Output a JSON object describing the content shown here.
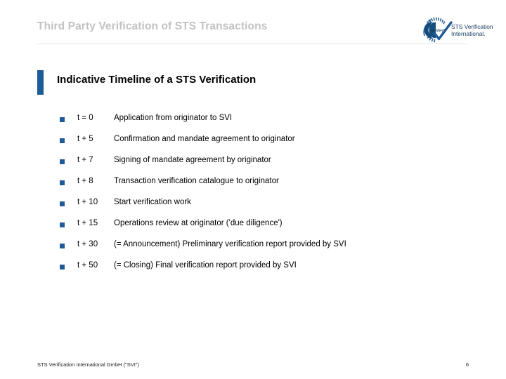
{
  "slide": {
    "title": "Third Party Verification of STS Transactions",
    "section_heading": "Indicative Timeline of a STS Verification",
    "accent_color": "#1f5b96",
    "title_color": "#c2c2c2"
  },
  "logo": {
    "badge_label": "verified",
    "icon": "verified-check-badge-icon",
    "line1": "STS Verification",
    "line2": "International.",
    "color": "#16395e"
  },
  "timeline": {
    "items": [
      {
        "time": "t = 0",
        "desc": "Application from originator to SVI"
      },
      {
        "time": "t + 5",
        "desc": "Confirmation and mandate agreement to originator"
      },
      {
        "time": "t + 7",
        "desc": "Signing of mandate agreement by originator"
      },
      {
        "time": "t + 8",
        "desc": "Transaction verification catalogue to originator"
      },
      {
        "time": "t + 10",
        "desc": "Start verification work"
      },
      {
        "time": "t + 15",
        "desc": "Operations review at originator ('due diligence')"
      },
      {
        "time": "t + 30",
        "desc": "(= Announcement) Preliminary verification report provided by SVI"
      },
      {
        "time": "t + 50",
        "desc": "(= Closing) Final verification report provided by SVI"
      }
    ]
  },
  "footer": {
    "text": "STS Verification International GmbH (\"SVI\")",
    "page_number": "6"
  }
}
